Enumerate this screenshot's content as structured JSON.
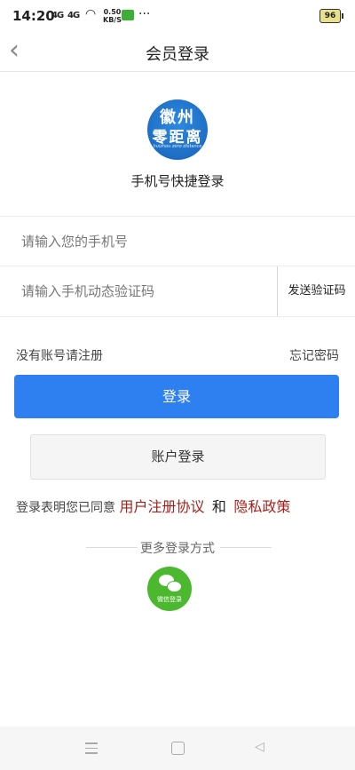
{
  "status_bar": {
    "time": "14:20",
    "signal1": "4G",
    "signal2": "4G",
    "net_speed": "0.50",
    "net_unit": "KB/S",
    "more": "···",
    "battery": "96"
  },
  "nav": {
    "back_icon": "chevron-left-icon",
    "title": "会员登录"
  },
  "logo": {
    "line1": "徽州",
    "line2": "零距离",
    "line3": "huizhou zero distance"
  },
  "subtitle": "手机号快捷登录",
  "phone_field": {
    "placeholder": "请输入您的手机号",
    "value": ""
  },
  "code_field": {
    "placeholder": "请输入手机动态验证码",
    "value": "",
    "send_label": "发送验证码"
  },
  "links": {
    "register": "没有账号请注册",
    "forgot": "忘记密码"
  },
  "login_button": "登录",
  "account_login_button": "账户登录",
  "agreement": {
    "prefix": "登录表明您已同意",
    "terms": "用户注册协议",
    "and": "和",
    "privacy": "隐私政策"
  },
  "more_methods": "更多登录方式",
  "wechat": {
    "icon": "wechat-icon",
    "label": "微信登录"
  },
  "colors": {
    "primary": "#2e7ff0",
    "link_red": "#a8201a",
    "wechat_green": "#4cb830"
  }
}
